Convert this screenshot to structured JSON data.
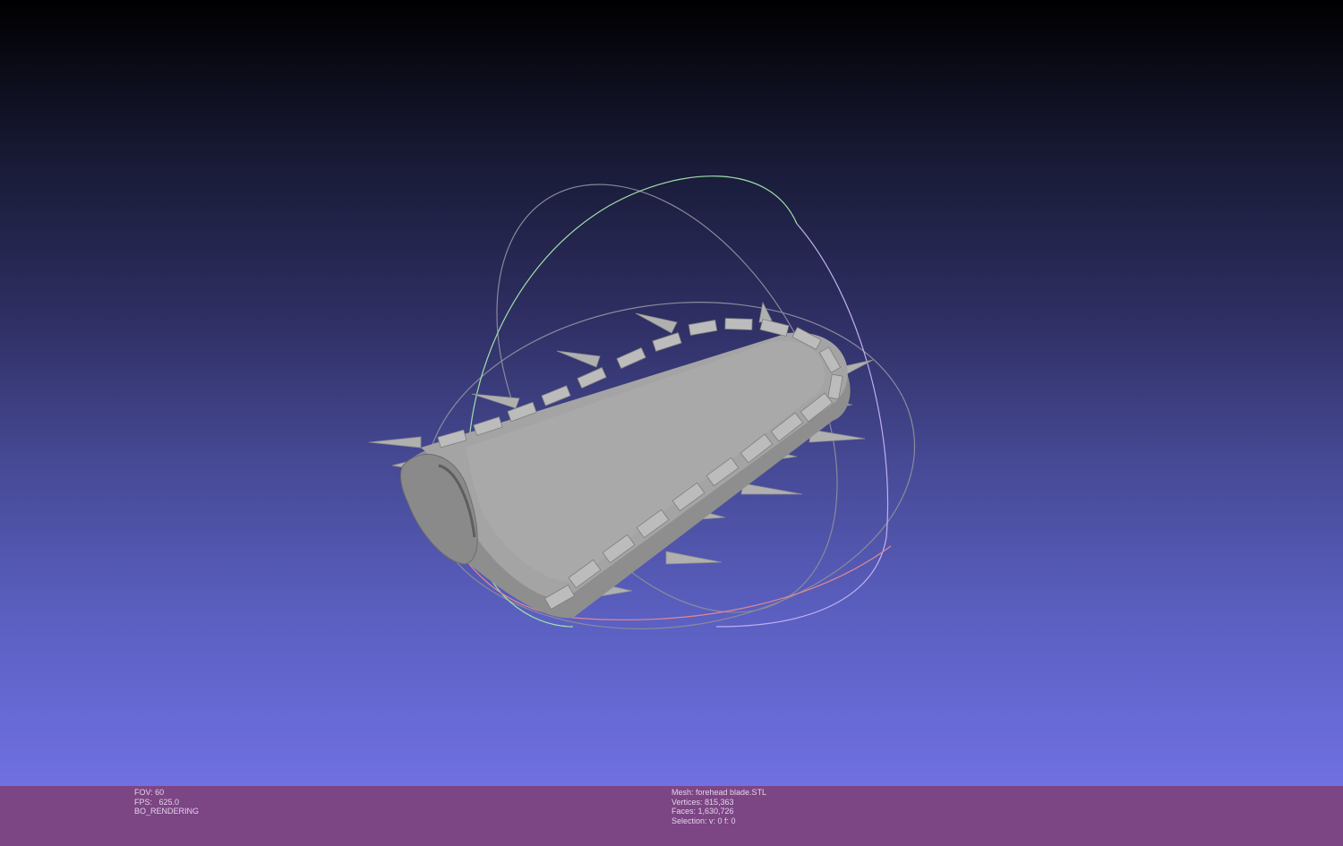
{
  "viewport": {
    "background_top": "#000000",
    "background_bottom": "#7070e2",
    "mesh_color": "#a3a3a3",
    "trackball_colors": {
      "x_ring": "#d8a0d0",
      "y_ring": "#a0e0a8",
      "z_ring": "#b0a8f0",
      "gray_ring": "#8a8a9a",
      "red_ring": "#e08890"
    }
  },
  "info": {
    "fov": "FOV: 60",
    "fps": "FPS:   625.0",
    "render_mode": "BO_RENDERING",
    "mesh": "Mesh: forehead blade.STL",
    "vertices": "Vertices: 815,363",
    "faces": "Faces: 1,630,726",
    "selection": "Selection: v: 0 f: 0"
  },
  "infobar_color": "#7c4584"
}
